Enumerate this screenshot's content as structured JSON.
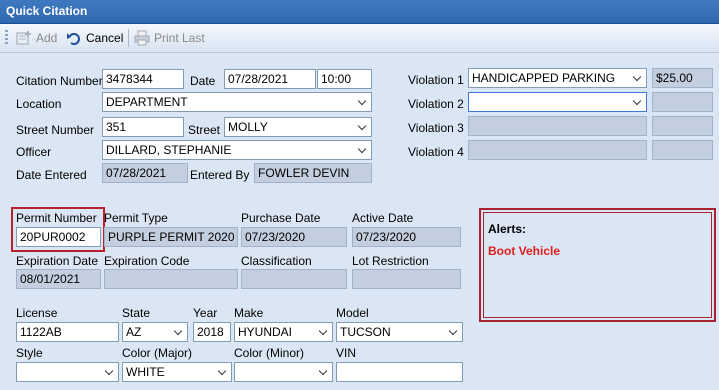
{
  "window": {
    "title": "Quick Citation"
  },
  "toolbar": {
    "add_label": "Add",
    "cancel_label": "Cancel",
    "print_last_label": "Print Last"
  },
  "labels": {
    "citation_number": "Citation Number",
    "date": "Date",
    "location": "Location",
    "street_number": "Street Number",
    "street": "Street",
    "officer": "Officer",
    "date_entered": "Date Entered",
    "entered_by": "Entered By",
    "violation1": "Violation 1",
    "violation2": "Violation 2",
    "violation3": "Violation 3",
    "violation4": "Violation 4",
    "permit_number": "Permit Number",
    "permit_type": "Permit Type",
    "purchase_date": "Purchase Date",
    "active_date": "Active Date",
    "expiration_date": "Expiration Date",
    "expiration_code": "Expiration Code",
    "classification": "Classification",
    "lot_restriction": "Lot Restriction",
    "license": "License",
    "state": "State",
    "year": "Year",
    "make": "Make",
    "model": "Model",
    "style": "Style",
    "color_major": "Color (Major)",
    "color_minor": "Color (Minor)",
    "vin": "VIN"
  },
  "values": {
    "citation_number": "3478344",
    "date": "07/28/2021",
    "time": "10:00",
    "location": "DEPARTMENT",
    "street_number": "351",
    "street": "MOLLY",
    "officer": "DILLARD, STEPHANIE",
    "date_entered": "07/28/2021",
    "entered_by": "FOWLER DEVIN",
    "violation1": "HANDICAPPED PARKING",
    "violation1_amount": "$25.00",
    "violation2": "",
    "violation2_amount": "",
    "violation3": "",
    "violation3_amount": "",
    "violation4": "",
    "violation4_amount": "",
    "permit_number": "20PUR0002",
    "permit_type": "PURPLE PERMIT 2020",
    "purchase_date": "07/23/2020",
    "active_date": "07/23/2020",
    "expiration_date": "08/01/2021",
    "expiration_code": "",
    "classification": "",
    "lot_restriction": "",
    "license": "1122AB",
    "state": "AZ",
    "year": "2018",
    "make": "HYUNDAI",
    "model": "TUCSON",
    "style": "",
    "color_major": "WHITE",
    "color_minor": "",
    "vin": ""
  },
  "alerts": {
    "title": "Alerts:",
    "items": [
      "Boot Vehicle"
    ]
  },
  "colors": {
    "titlebar": "#2f68b0",
    "alert_text": "#e21b1b",
    "highlight": "#b8202f"
  }
}
